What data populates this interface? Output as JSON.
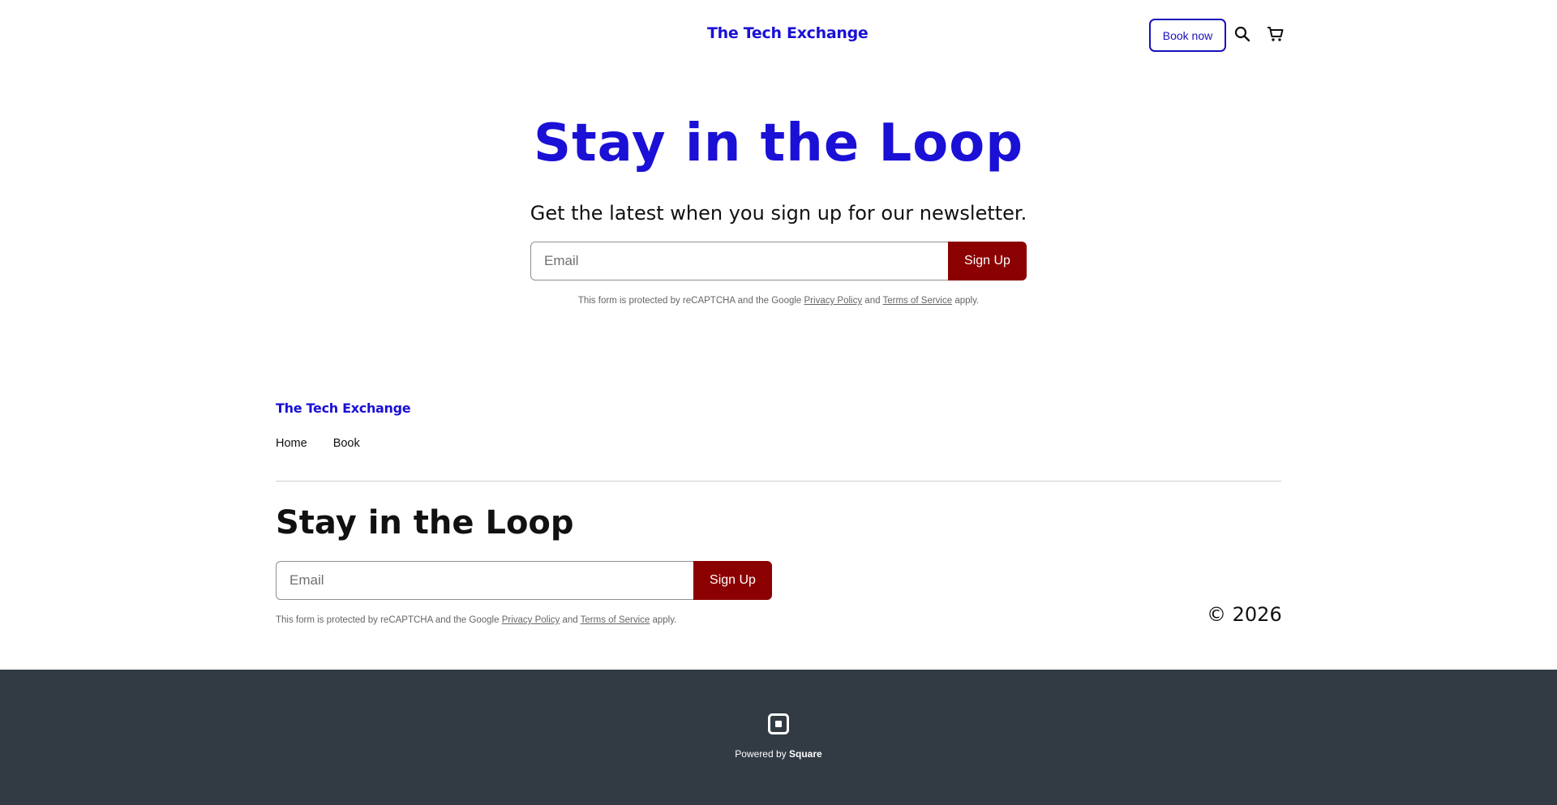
{
  "header": {
    "brand": "The Tech Exchange",
    "book_now_label": "Book now",
    "search_icon": "search-icon",
    "cart_icon": "cart-icon"
  },
  "hero": {
    "title": "Stay in the Loop",
    "subtitle": "Get the latest when you sign up for our newsletter.",
    "email_placeholder": "Email",
    "signup_label": "Sign Up",
    "legal_prefix": "This form is protected by reCAPTCHA and the Google",
    "privacy_label": "Privacy Policy",
    "and_text": "and",
    "terms_label": "Terms of Service",
    "legal_suffix": "apply."
  },
  "footer": {
    "brand": "The Tech Exchange",
    "nav": [
      "Home",
      "Book"
    ],
    "title": "Stay in the Loop",
    "email_placeholder": "Email",
    "signup_label": "Sign Up",
    "legal_prefix": "This form is protected by reCAPTCHA and the Google",
    "privacy_label": "Privacy Policy",
    "and_text": "and",
    "terms_label": "Terms of Service",
    "legal_suffix": "apply.",
    "copyright": "© 2026"
  },
  "powered": {
    "prefix": "Powered by",
    "brand": "Square",
    "logo_icon": "square-logo-icon"
  },
  "colors": {
    "brand_blue": "#1a10d6",
    "signup_red": "#8b0000",
    "footer_bar": "#323b44"
  }
}
